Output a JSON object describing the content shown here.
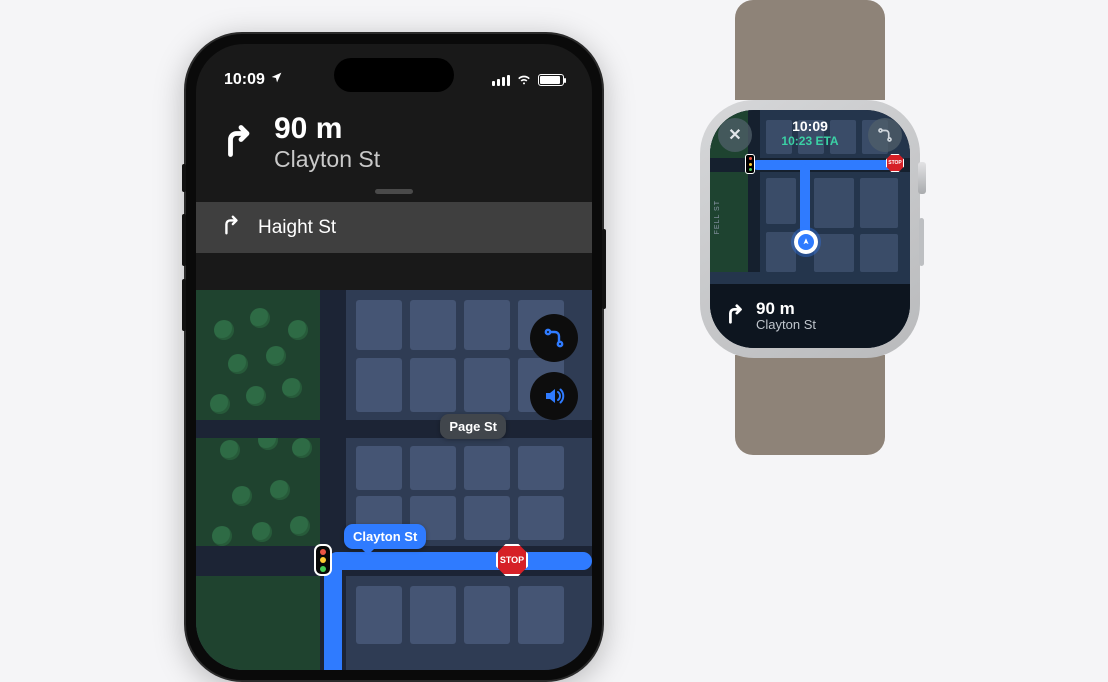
{
  "phone": {
    "status": {
      "time": "10:09"
    },
    "nav_primary": {
      "direction_icon": "turn-right",
      "distance": "90 m",
      "street": "Clayton St"
    },
    "nav_secondary": {
      "direction_icon": "turn-right",
      "street": "Haight St"
    },
    "map": {
      "label_page": "Page St",
      "label_clayton": "Clayton St",
      "stop_text": "STOP",
      "fabs": {
        "route": "route-overview",
        "audio": "audio-on"
      }
    }
  },
  "watch": {
    "top": {
      "time": "10:09",
      "eta": "10:23 ETA"
    },
    "close_label": "✕",
    "map": {
      "side_label": "FELL ST",
      "stop_text": "STOP"
    },
    "nav": {
      "direction_icon": "turn-right",
      "distance": "90 m",
      "street": "Clayton St"
    }
  }
}
